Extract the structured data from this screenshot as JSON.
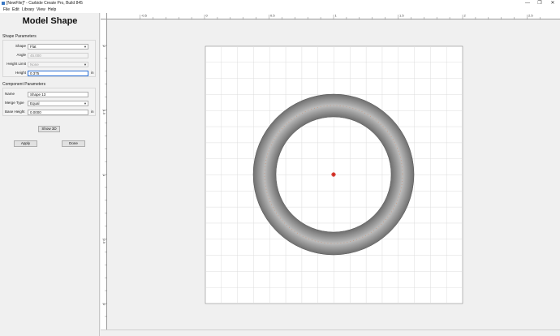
{
  "window": {
    "title": "[NewFile]* - Carbide Create Pro, Build 845",
    "minimize_glyph": "—",
    "maximize_glyph": "❐",
    "close_glyph": "✕"
  },
  "menu": {
    "items": [
      {
        "label": "File"
      },
      {
        "label": "Edit"
      },
      {
        "label": "Library"
      },
      {
        "label": "View"
      },
      {
        "label": "Help"
      }
    ]
  },
  "panel": {
    "title": "Model Shape",
    "shape_section": {
      "label": "Shape Parameters",
      "shape_label": "Shape",
      "shape_value": "Flat",
      "angle_label": "Angle",
      "angle_value": "45.000",
      "height_limit_label": "Height Limit",
      "height_limit_value": "None",
      "height_label": "Height",
      "height_value": "0.375",
      "height_unit": "in"
    },
    "component_section": {
      "label": "Component Parameters",
      "name_label": "Name",
      "name_value": "Shape 13",
      "merge_label": "Merge Type",
      "merge_value": "Equal",
      "base_height_label": "Base Height",
      "base_height_value": "0.0000",
      "base_height_unit": "in"
    },
    "show3d_label": "Show 3D",
    "apply_label": "Apply",
    "done_label": "Done"
  },
  "ruler": {
    "top_labels": [
      "-0.5",
      "0",
      "0.5",
      "1",
      "1.5",
      "2",
      "2.5"
    ],
    "left_labels": [
      "2",
      "1.5",
      "1",
      "0.5",
      "0"
    ]
  },
  "colors": {
    "ring_dark": "#6f6f6f",
    "ring_light": "#bdbdbd",
    "grid": "#dcdcdc",
    "origin_marker": "#d0271d",
    "toolpath_dots": "#c88a6a"
  }
}
